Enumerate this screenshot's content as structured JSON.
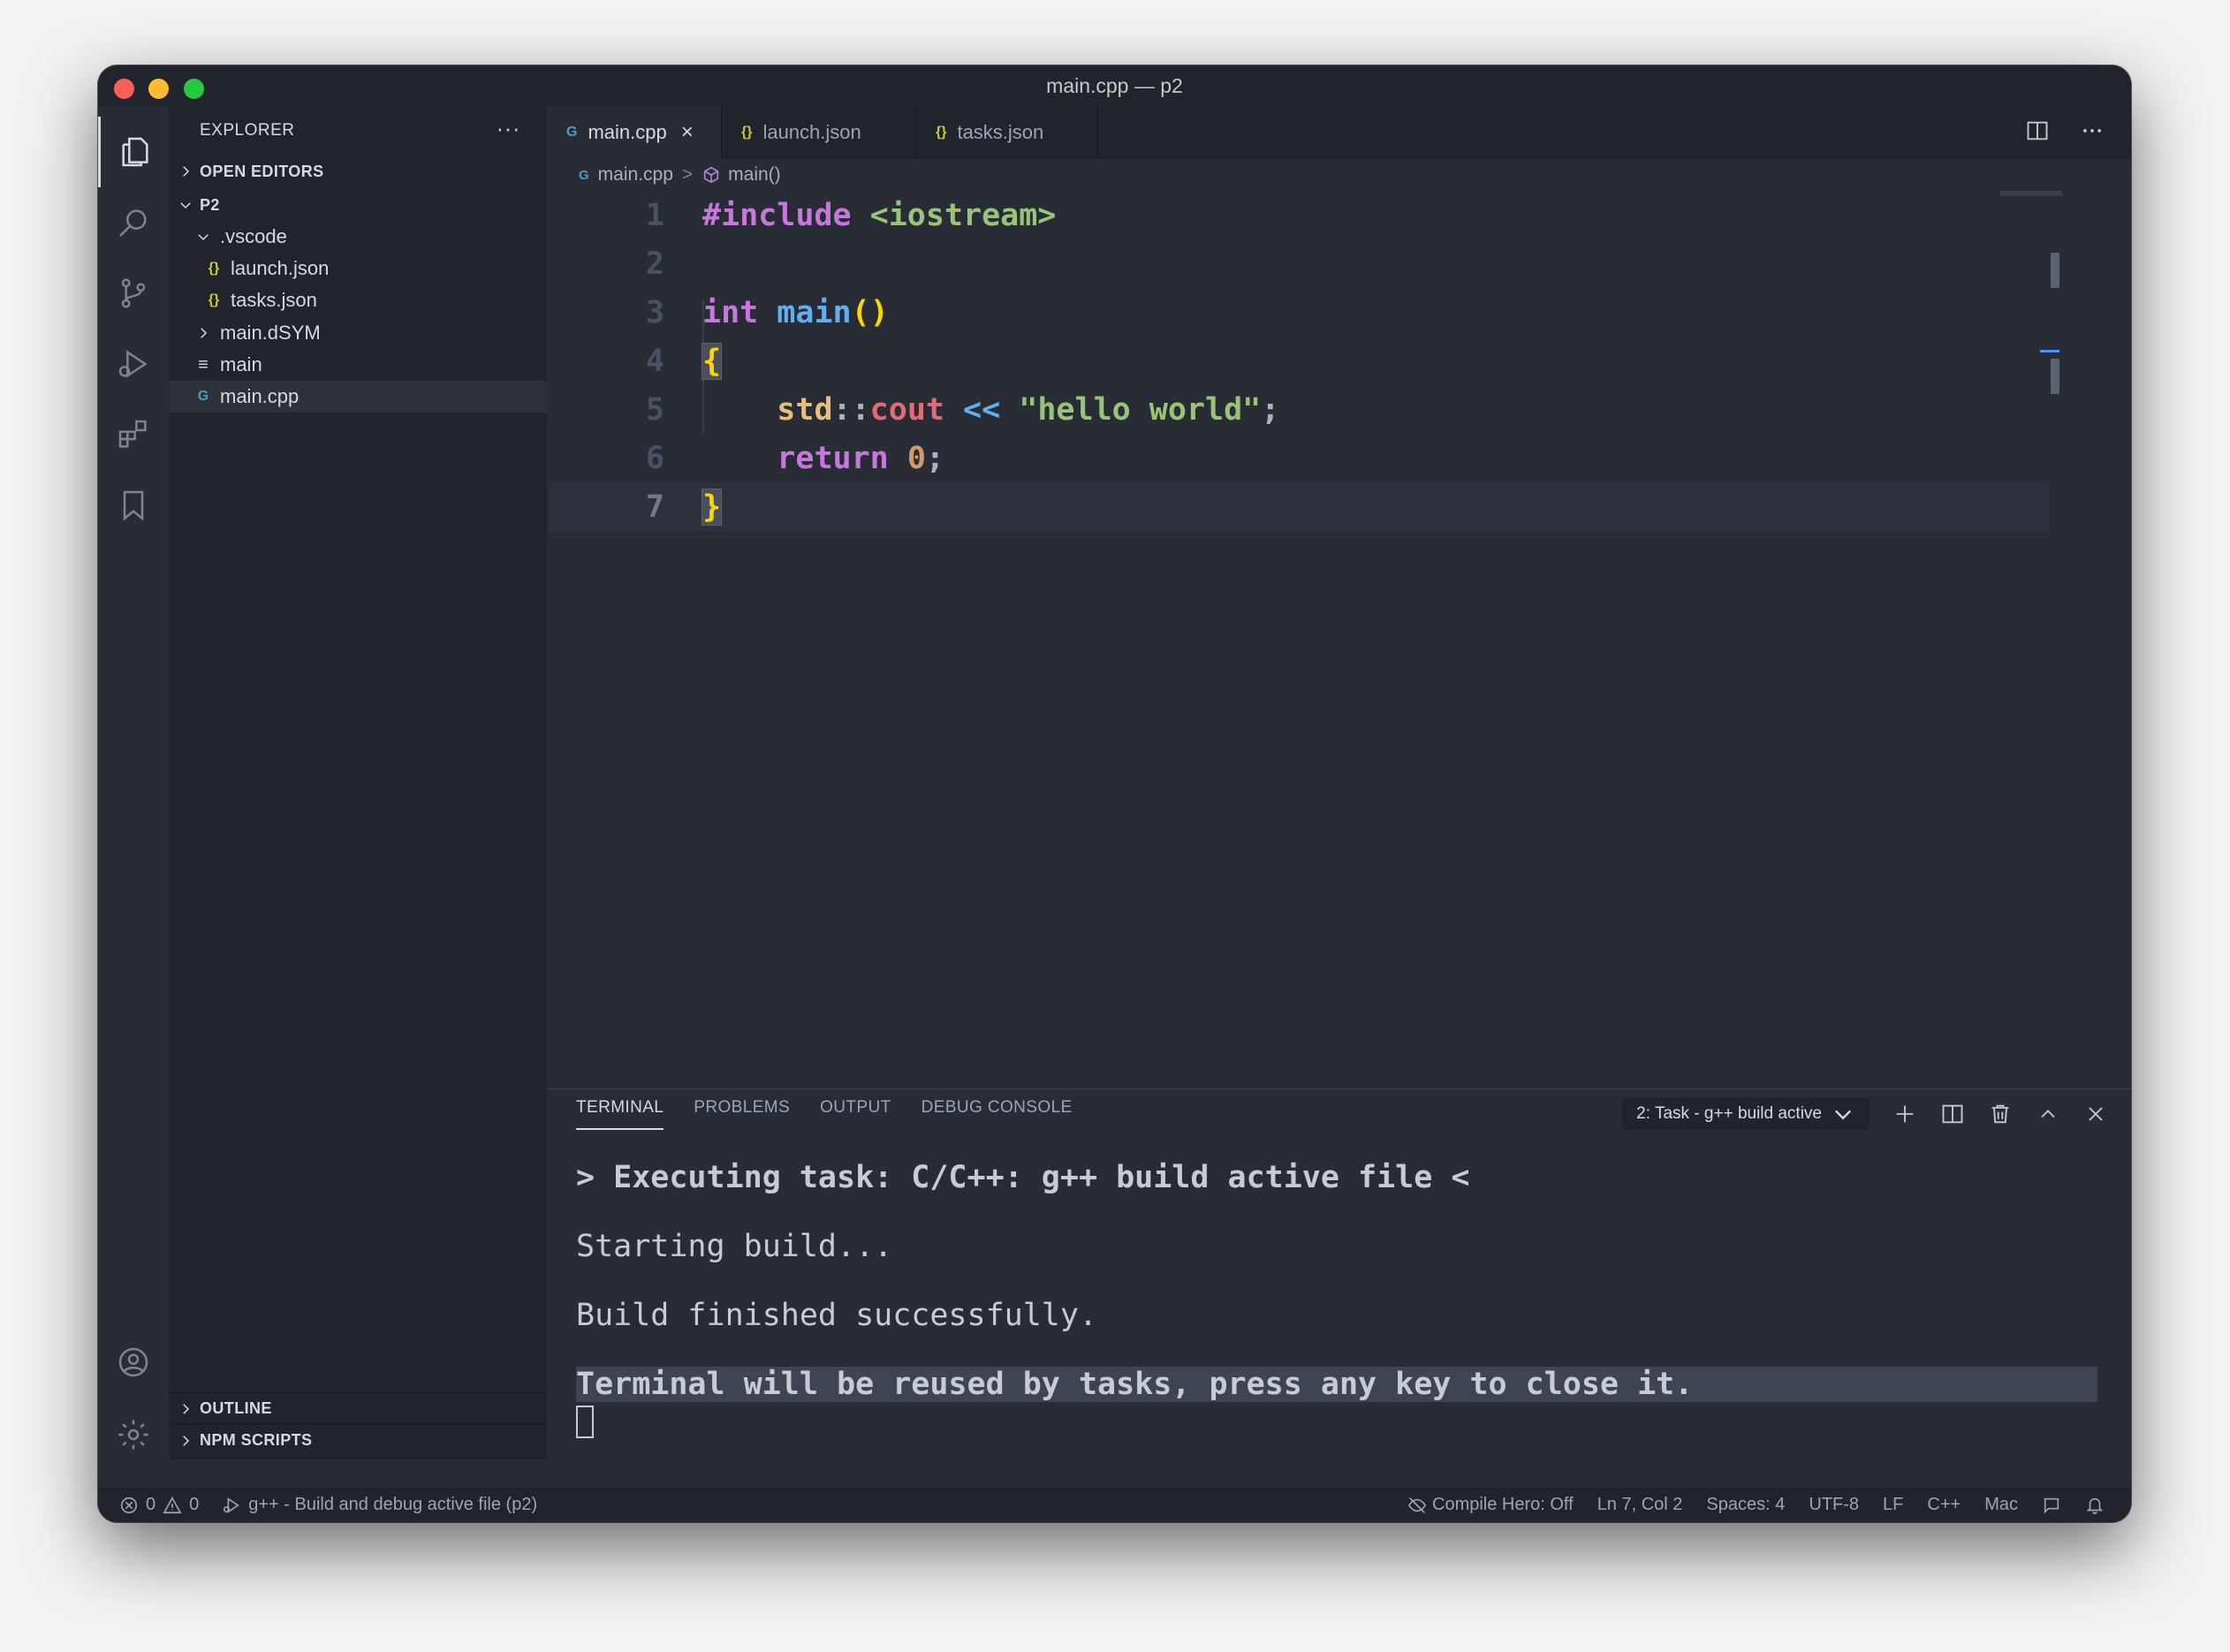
{
  "window": {
    "title": "main.cpp — p2"
  },
  "sidebar": {
    "title": "EXPLORER",
    "more": "···",
    "sections": {
      "open_editors": "OPEN EDITORS",
      "project": "P2",
      "outline": "OUTLINE",
      "npm_scripts": "NPM SCRIPTS"
    },
    "tree": [
      {
        "label": ".vscode",
        "icon": "chevron-down-icon",
        "glyph": ""
      },
      {
        "label": "launch.json",
        "icon": "json-icon",
        "glyph": "{}"
      },
      {
        "label": "tasks.json",
        "icon": "json-icon",
        "glyph": "{}"
      },
      {
        "label": "main.dSYM",
        "icon": "chevron-right-icon",
        "glyph": ""
      },
      {
        "label": "main",
        "icon": "file-lines-icon",
        "glyph": "≡"
      },
      {
        "label": "main.cpp",
        "icon": "cpp-file-icon",
        "glyph": "G"
      }
    ]
  },
  "tabs": [
    {
      "label": "main.cpp",
      "glyph": "G",
      "active": true,
      "close": "×"
    },
    {
      "label": "launch.json",
      "glyph": "{}",
      "active": false
    },
    {
      "label": "tasks.json",
      "glyph": "{}",
      "active": false
    }
  ],
  "breadcrumb": {
    "file": "main.cpp",
    "separator": ">",
    "symbol": "main()"
  },
  "editor": {
    "line_numbers": [
      "1",
      "2",
      "3",
      "4",
      "5",
      "6",
      "7"
    ],
    "code": {
      "l1_directive": "#include",
      "l1_header": "<iostream>",
      "l3_type": "int",
      "l3_func": "main",
      "l3_parens": "()",
      "l4_brace": "{",
      "l5_ns": "std",
      "l5_scope": "::",
      "l5_obj": "cout",
      "l5_op": "<<",
      "l5_str": "\"hello world\"",
      "l5_semi": ";",
      "l6_kw": "return",
      "l6_num": "0",
      "l6_semi": ";",
      "l7_brace": "}"
    }
  },
  "panel": {
    "tabs": [
      "TERMINAL",
      "PROBLEMS",
      "OUTPUT",
      "DEBUG CONSOLE"
    ],
    "terminal_select": "2: Task - g++ build active",
    "lines": [
      "> Executing task: C/C++: g++ build active file <",
      "Starting build...",
      "Build finished successfully.",
      "Terminal will be reused by tasks, press any key to close it."
    ]
  },
  "statusbar": {
    "errors": "0",
    "warnings": "0",
    "task": "g++ - Build and debug active file (p2)",
    "compile_hero": "Compile Hero: Off",
    "position": "Ln 7, Col 2",
    "spaces": "Spaces: 4",
    "encoding": "UTF-8",
    "eol": "LF",
    "language": "C++",
    "platform": "Mac"
  },
  "colors": {
    "background": "#282c34",
    "sidebar": "#21252b",
    "json_icon": "#cbcb41",
    "cpp_icon": "#519aba"
  }
}
